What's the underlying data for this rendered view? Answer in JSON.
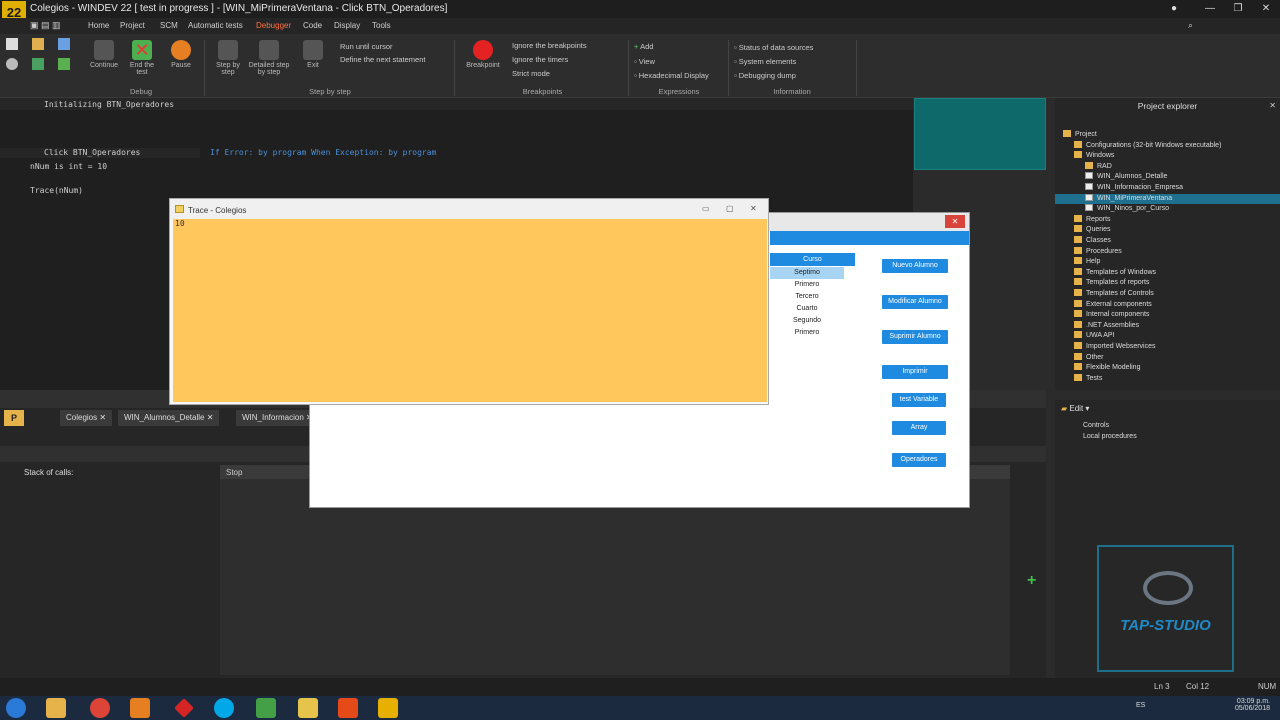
{
  "window": {
    "logo": "22",
    "title": "Colegios - WINDEV 22 [ test in progress ] - [WIN_MiPrimeraVentana - Click BTN_Operadores]"
  },
  "menu": [
    "Home",
    "Project",
    "SCM",
    "Automatic tests",
    "Debugger",
    "Code",
    "Display",
    "Tools"
  ],
  "ribbon": {
    "continue": "Continue",
    "end_test": "End the test",
    "pause": "Pause",
    "debug_group": "Debug",
    "step_by_step": "Step by step",
    "detailed_step": "Detailed step by step",
    "exit": "Exit",
    "run_until_cursor": "Run until cursor",
    "define_next": "Define the next statement",
    "step_group": "Step by step",
    "breakpoint": "Breakpoint",
    "ignore_breakpoints": "Ignore the breakpoints",
    "ignore_timers": "Ignore the timers",
    "strict_mode": "Strict mode",
    "breakpoints_group": "Breakpoints",
    "add": "Add",
    "view": "View",
    "hex_display": "Hexadecimal Display",
    "expressions_group": "Expressions",
    "status_sources": "Status of data sources",
    "system_elements": "System elements",
    "debug_dump": "Debugging dump",
    "information_group": "Information"
  },
  "editor": {
    "init_line": "Initializing BTN_Operadores",
    "click_line": "Click BTN_Operadores",
    "if_error": "If Error: by program  When Exception: by program",
    "code1": "nNum is int = 10",
    "code2": "Trace(nNum)"
  },
  "project_explorer": {
    "title": "Project explorer",
    "items": [
      {
        "label": "Project",
        "indent": 0
      },
      {
        "label": "Configurations (32-bit Windows executable)",
        "indent": 1
      },
      {
        "label": "Windows",
        "indent": 1
      },
      {
        "label": "RAD",
        "indent": 2
      },
      {
        "label": "WIN_Alumnos_Detalle",
        "indent": 2
      },
      {
        "label": "WIN_Informacion_Empresa",
        "indent": 2
      },
      {
        "label": "WIN_MiPrimeraVentana",
        "indent": 2
      },
      {
        "label": "WIN_Ninos_por_Curso",
        "indent": 2
      },
      {
        "label": "Reports",
        "indent": 1
      },
      {
        "label": "Queries",
        "indent": 1
      },
      {
        "label": "Classes",
        "indent": 1
      },
      {
        "label": "Procedures",
        "indent": 1
      },
      {
        "label": "Help",
        "indent": 1
      },
      {
        "label": "Templates of Windows",
        "indent": 1
      },
      {
        "label": "Templates of reports",
        "indent": 1
      },
      {
        "label": "Templates of Controls",
        "indent": 1
      },
      {
        "label": "External components",
        "indent": 1
      },
      {
        "label": "Internal components",
        "indent": 1
      },
      {
        "label": ".NET Assemblies",
        "indent": 1
      },
      {
        "label": "UWA API",
        "indent": 1
      },
      {
        "label": "Imported Webservices",
        "indent": 1
      },
      {
        "label": "Other",
        "indent": 1
      },
      {
        "label": "Flexible Modeling",
        "indent": 1
      },
      {
        "label": "Tests",
        "indent": 1
      }
    ]
  },
  "edit_panel": {
    "title": "Edit",
    "controls": "Controls",
    "local_procedures": "Local procedures"
  },
  "debug_tabs": [
    "Colegios",
    "WIN_Alumnos_Detalle",
    "WIN_Informacion"
  ],
  "debug": {
    "stack_label": "Stack of calls:",
    "stop_label": "Stop"
  },
  "app_window": {
    "list_header": "Curso",
    "list_items": [
      "Septimo",
      "Primero",
      "Tercero",
      "Cuarto",
      "Segundo",
      "Primero"
    ],
    "buttons": [
      "Nuevo Alumno",
      "Modificar Alumno",
      "Suprimir Alumno",
      "Imprimir",
      "test Variable",
      "Array",
      "Operadores"
    ]
  },
  "trace": {
    "title": "Trace - Colegios",
    "value": "10"
  },
  "statusbar": {
    "ln": "Ln 3",
    "col": "Col 12",
    "num": "NUM"
  },
  "taskbar": {
    "lang": "ES",
    "time": "03:09 p.m.",
    "date": "05/06/2018"
  },
  "watermark": {
    "text": "TAP-STUDIO"
  },
  "colors": {
    "trace_bg": "#ffc75c",
    "accent_blue": "#1e8ae0",
    "debugger_tab": "#ff7040"
  }
}
